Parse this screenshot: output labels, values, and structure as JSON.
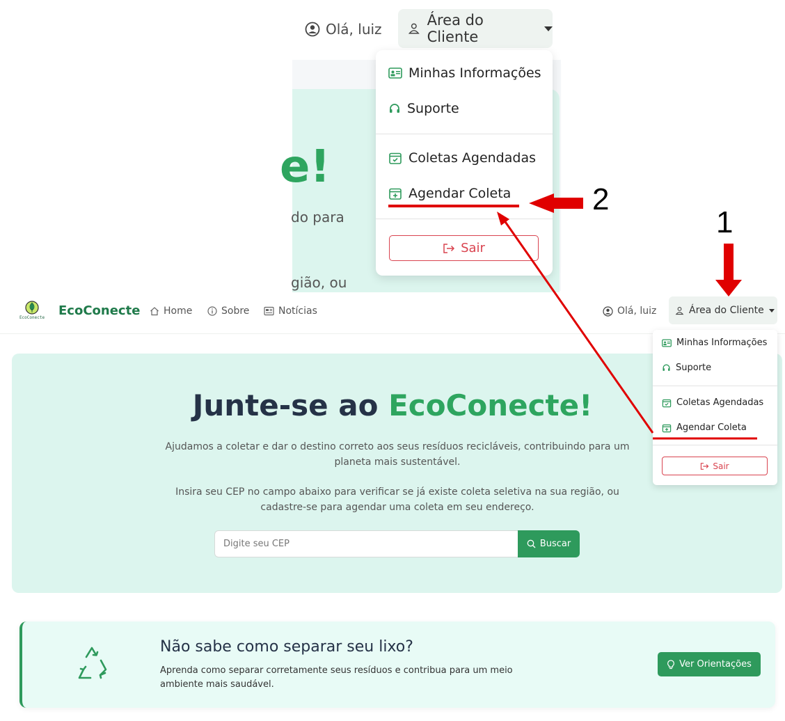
{
  "zoom": {
    "greeting": "Olá, luiz",
    "client_area": "Área do Cliente",
    "hero_fragment_title": "e!",
    "hero_fragment_line1": "do para",
    "hero_fragment_line2": "gião, ou",
    "menu": {
      "minhas_informacoes": "Minhas Informações",
      "suporte": "Suporte",
      "coletas_agendadas": "Coletas Agendadas",
      "agendar_coleta": "Agendar Coleta",
      "sair": "Sair"
    }
  },
  "annotations": {
    "step1": "1",
    "step2": "2",
    "color": "#e00000"
  },
  "navbar": {
    "logo_text": "EcoConecte",
    "brand": "EcoConecte",
    "links": [
      "Home",
      "Sobre",
      "Notícias"
    ],
    "greeting": "Olá, luiz",
    "client_area": "Área do Cliente"
  },
  "dropdown": {
    "minhas_informacoes": "Minhas Informações",
    "suporte": "Suporte",
    "coletas_agendadas": "Coletas Agendadas",
    "agendar_coleta": "Agendar Coleta",
    "sair": "Sair"
  },
  "hero": {
    "title_main": "Junte-se ao ",
    "title_accent": "EcoConecte!",
    "paragraph1": "Ajudamos a coletar e dar o destino correto aos seus resíduos recicláveis, contribuindo para um planeta mais sustentável.",
    "paragraph2": "Insira seu CEP no campo abaixo para verificar se já existe coleta seletiva na sua região, ou cadastre-se para agendar uma coleta em seu endereço.",
    "search_placeholder": "Digite seu CEP",
    "search_button": "Buscar"
  },
  "tip": {
    "title": "Não sabe como separar seu lixo?",
    "description": "Aprenda como separar corretamente seus resíduos e contribua para um meio ambiente mais saudável.",
    "button": "Ver Orientações"
  },
  "colors": {
    "brand_green": "#2e9a5c",
    "accent_green": "#2ea55f",
    "hero_bg": "#dcf5ee",
    "danger": "#d9434f",
    "dark_text": "#253247"
  }
}
